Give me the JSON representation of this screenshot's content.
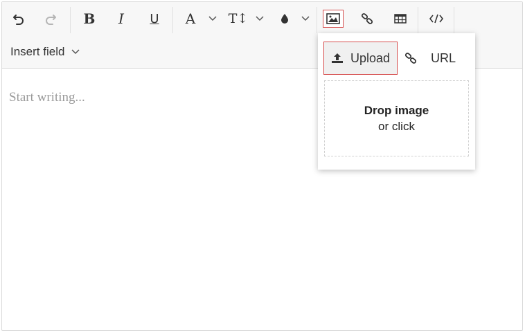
{
  "toolbar": {
    "undo_icon": "undo-icon",
    "redo_icon": "redo-icon",
    "bold_label": "B",
    "italic_label": "I",
    "underline_label": "U",
    "font_color_label": "A",
    "font_size_label": "T↕",
    "image_icon": "image-icon",
    "link_icon": "link-icon",
    "table_icon": "table-icon",
    "source_icon": "code-view-icon",
    "insert_field_label": "Insert field"
  },
  "editor": {
    "placeholder": "Start writing..."
  },
  "image_popup": {
    "upload_label": "Upload",
    "url_label": "URL",
    "drop_title": "Drop image",
    "drop_subtitle": "or click"
  },
  "colors": {
    "active_outline": "#d54b4b",
    "toolbar_bg": "#f7f7f7"
  }
}
